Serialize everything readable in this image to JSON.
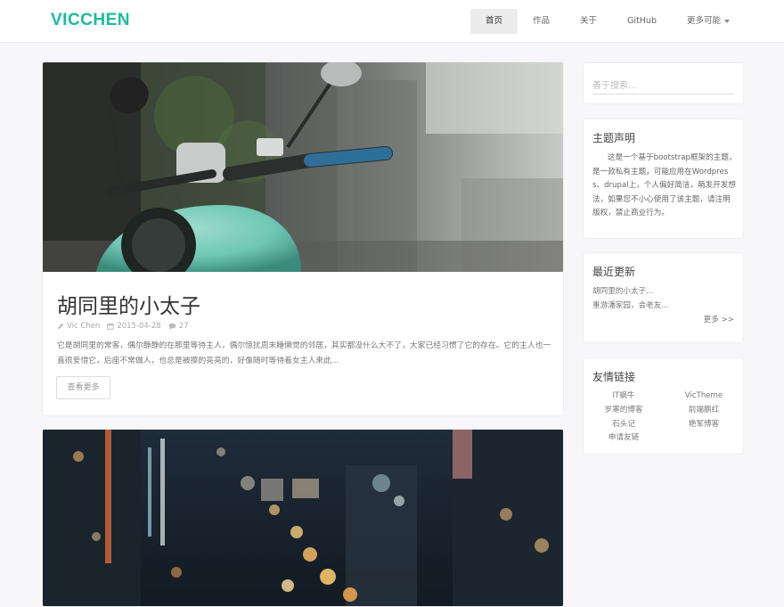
{
  "brand": "VICCHEN",
  "nav": [
    {
      "label": "首页",
      "active": true
    },
    {
      "label": "作品",
      "active": false
    },
    {
      "label": "关于",
      "active": false
    },
    {
      "label": "GitHub",
      "active": false
    },
    {
      "label": "更多可能",
      "active": false,
      "dropdown": true
    }
  ],
  "posts": [
    {
      "title": "胡同里的小太子",
      "author": "Vic Chen",
      "date": "2015-04-28",
      "comments": "27",
      "excerpt": "它是胡同里的常客，偶尔静静的在那里等待主人，偶尔惊扰周末睡懒觉的邻居，其实都没什么大不了，大家已经习惯了它的存在。它的主人也一直很爱惜它，后座不常做人，也总是被擦的亮亮的，好像随时等待着女主人来此...",
      "more_label": "查看更多"
    }
  ],
  "sidebar": {
    "search_placeholder": "善于搜索...",
    "about": {
      "title": "主题声明",
      "text": "这是一个基于bootstrap框架的主题，是一款私有主题，可能应用在Wordpress、drupal上，个人偏好简洁，萌发开发想法，如果您不小心使用了该主题，请注明版权，禁止商业行为。"
    },
    "recent": {
      "title": "最近更新",
      "items": [
        "胡同里的小太子...",
        "重游潘家园，会老友..."
      ],
      "more": "更多 >>"
    },
    "links": {
      "title": "友情链接",
      "items": [
        "IT蜗牛",
        "VicTheme",
        "岁寒的博客",
        "前端鹏红",
        "石头记",
        "艳军博客",
        "申请友链"
      ]
    }
  },
  "colors": {
    "brand": "#1abc9c",
    "scooter": "#6fc7b4"
  }
}
